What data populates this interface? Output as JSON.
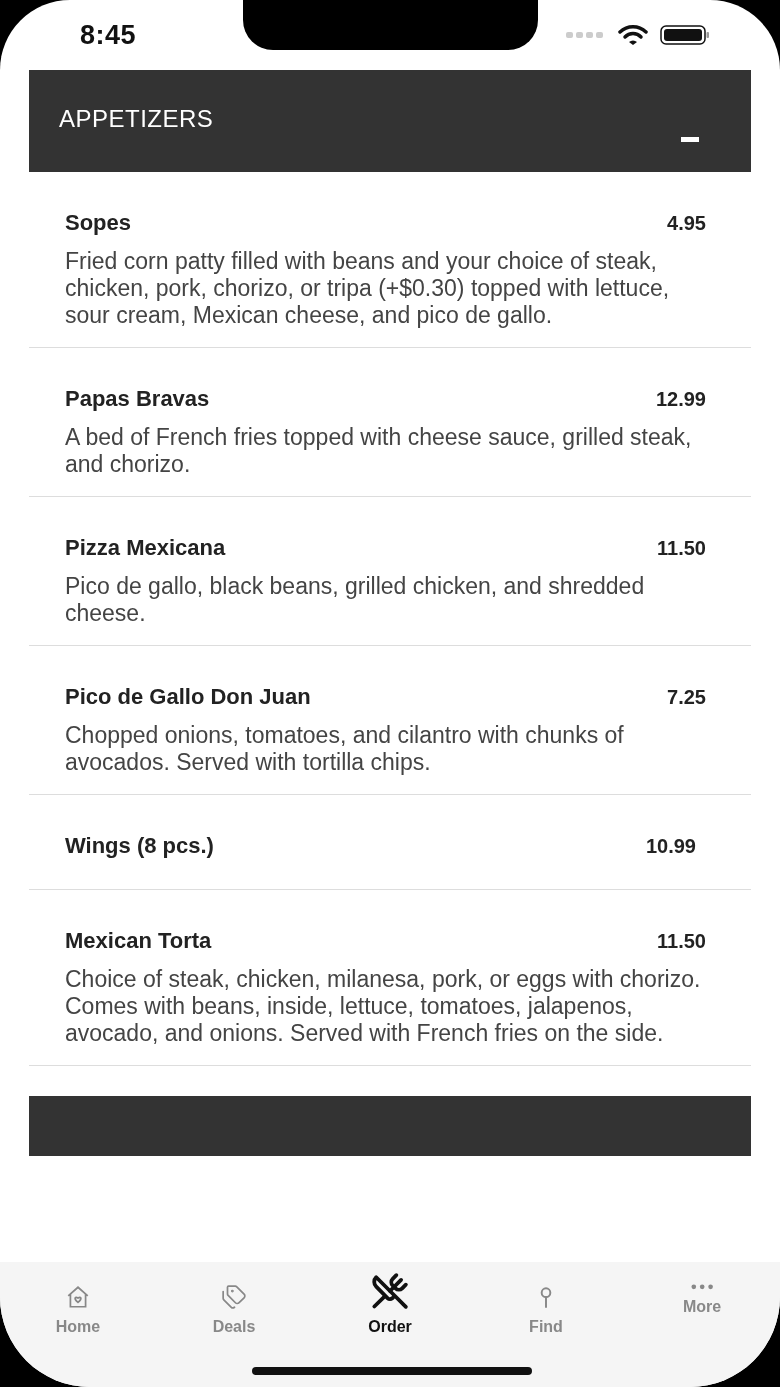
{
  "status_bar": {
    "time": "8:45"
  },
  "section": {
    "title": "APPETIZERS",
    "expanded": true
  },
  "items": [
    {
      "name": "Sopes",
      "price": "4.95",
      "description": "Fried corn patty filled with beans and your choice of steak, chicken, pork, chorizo, or tripa (+$0.30) topped with lettuce, sour cream, Mexican cheese, and pico de gallo."
    },
    {
      "name": "Papas Bravas",
      "price": "12.99",
      "description": "A bed of French fries topped with cheese sauce, grilled steak, and chorizo."
    },
    {
      "name": "Pizza Mexicana",
      "price": "11.50",
      "description": "Pico de gallo, black beans, grilled chicken, and shredded cheese."
    },
    {
      "name": "Pico de Gallo Don Juan",
      "price": "7.25",
      "description": "Chopped onions, tomatoes, and cilantro with chunks of avocados. Served with tortilla chips."
    },
    {
      "name": "Wings (8 pcs.)",
      "price": "10.99"
    },
    {
      "name": "Mexican Torta",
      "price": "11.50",
      "description": "Choice of steak, chicken, milanesa, pork, or eggs with chorizo. Comes with beans, inside, lettuce, tomatoes, jalapenos, avocado, and onions. Served with French fries on the side."
    }
  ],
  "tabs": [
    {
      "label": "Home",
      "selected": false
    },
    {
      "label": "Deals",
      "selected": false
    },
    {
      "label": "Order",
      "selected": true
    },
    {
      "label": "Find",
      "selected": false
    },
    {
      "label": "More",
      "selected": false
    }
  ]
}
